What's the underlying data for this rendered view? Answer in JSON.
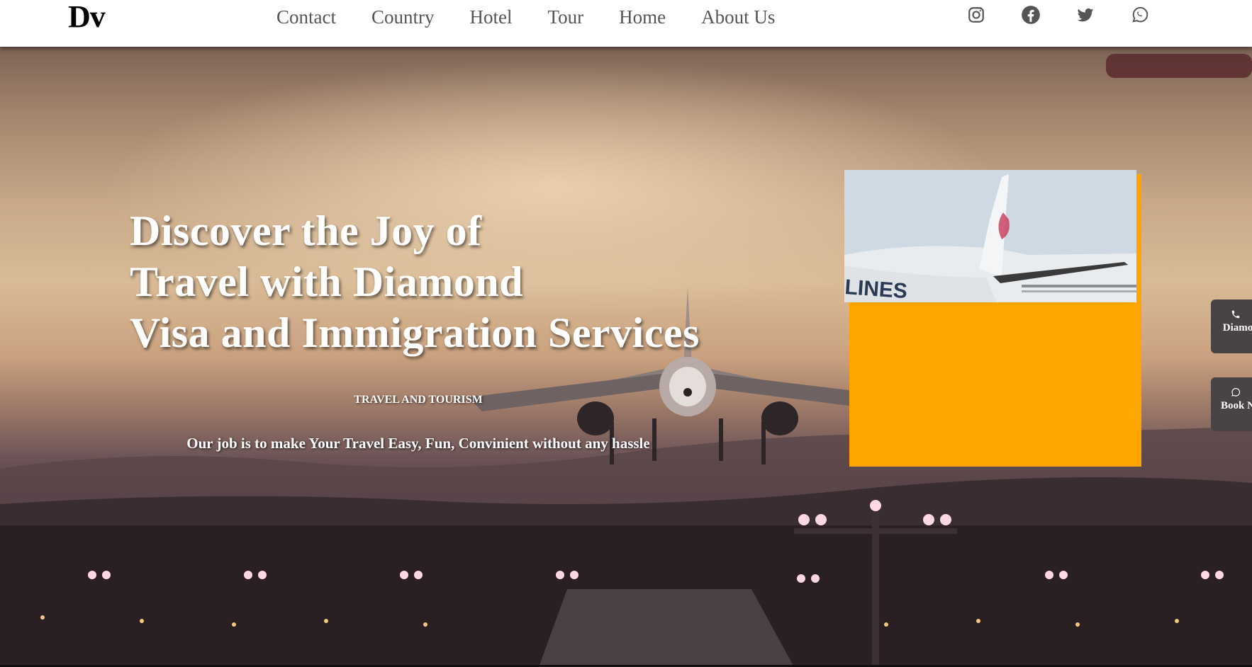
{
  "header": {
    "logo": "Dv",
    "nav": [
      "Contact",
      "Country",
      "Hotel",
      "Tour",
      "Home",
      "About Us"
    ],
    "social_icons": [
      "instagram-icon",
      "facebook-icon",
      "twitter-icon",
      "whatsapp-icon"
    ]
  },
  "hero": {
    "title_lines": [
      "Discover the Joy of",
      "Travel with Diamond",
      "Visa and Immigration Services"
    ],
    "tagline": "TRAVEL AND TOURISM",
    "subtitle": "Our job is to make Your Travel Easy, Fun, Convinient without any hassle"
  },
  "feature_card": {
    "image_text": "LINES",
    "accent_color": "#ffa500"
  },
  "side_buttons": {
    "call": {
      "label": "Diamo",
      "icon": "phone-icon"
    },
    "book": {
      "label": "Book N",
      "icon": "whatsapp-icon"
    }
  }
}
